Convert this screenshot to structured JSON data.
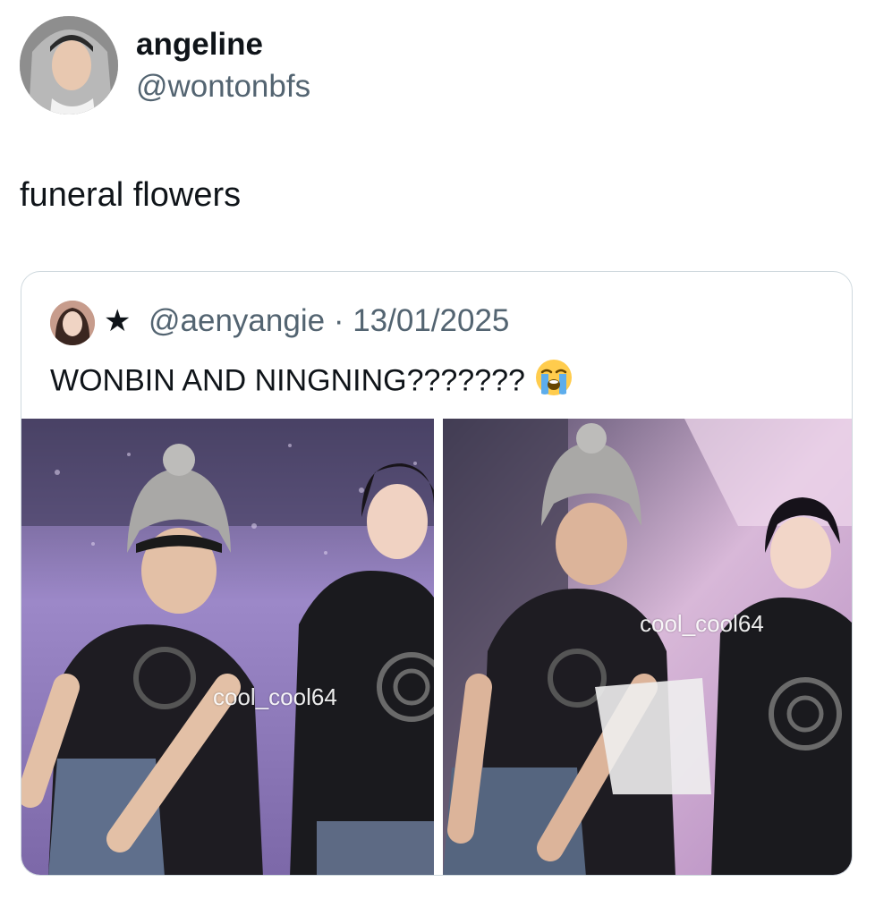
{
  "author": {
    "display_name": "angeline",
    "handle": "@wontonbfs"
  },
  "tweet": {
    "text": "funeral flowers"
  },
  "quoted_tweet": {
    "handle": "@aenyangie",
    "separator": "·",
    "date": "13/01/2025",
    "text": "WONBIN AND NINGNING???????",
    "emoji": "loudly-crying-face",
    "star_icon": "★",
    "watermark_left": "cool_cool64",
    "watermark_right": "cool_cool64"
  },
  "colors": {
    "primary_text": "#0f1419",
    "secondary_text": "#536471",
    "card_border": "#cfd9de",
    "stage_purple": "#8a72b8"
  }
}
